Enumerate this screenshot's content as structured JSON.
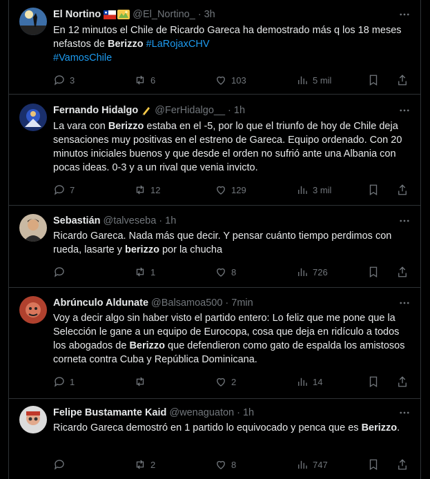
{
  "tweets": [
    {
      "name": "El Nortino",
      "handle": "@El_Nortino_",
      "time": "3h",
      "text_1": "En 12 minutos el Chile de Ricardo Gareca ha demostrado más q los 18 meses nefastos de ",
      "text_2": "Berizzo",
      "text_3": " ",
      "text_4": "#LaRojaxCHV",
      "text_5": "#VamosChile",
      "replies": "3",
      "reposts": "6",
      "likes": "103",
      "views": "5 mil"
    },
    {
      "name": "Fernando Hidalgo",
      "handle": "@FerHidalgo__",
      "time": "1h",
      "text_1": "La vara con ",
      "text_2": "Berizzo",
      "text_3": " estaba en el -5, por lo que el triunfo de hoy de Chile deja sensaciones muy positivas en el estreno de Gareca. Equipo ordenado. Con 20 minutos iniciales buenos y que desde el orden no sufrió ante una Albania con pocas ideas. 0-3 y a un rival que venia invicto.",
      "replies": "7",
      "reposts": "12",
      "likes": "129",
      "views": "3 mil"
    },
    {
      "name": "Sebastián",
      "handle": "@talveseba",
      "time": "1h",
      "text_1": "Ricardo Gareca. Nada más que decir. Y pensar cuánto tiempo perdimos con rueda, lasarte y ",
      "text_2": "berizzo",
      "text_3": " por la chucha",
      "replies": "",
      "reposts": "1",
      "likes": "8",
      "views": "726"
    },
    {
      "name": "Abrúnculo Aldunate",
      "handle": "@Balsamoa500",
      "time": "7min",
      "text_1": "Voy a decir algo sin haber visto el partido entero: Lo feliz que me pone que la Selección le gane a un equipo de Eurocopa, cosa que deja en ridículo a todos los abogados de ",
      "text_2": "Berizzo",
      "text_3": " que defendieron como gato de espalda los amistosos corneta contra Cuba y República Dominicana.",
      "replies": "1",
      "reposts": "",
      "likes": "2",
      "views": "14"
    },
    {
      "name": "Felipe Bustamante Kaid",
      "handle": "@wenaguaton",
      "time": "1h",
      "text_1": "Ricardo Gareca demostró en 1 partido lo equivocado y penca que es ",
      "text_2": "Berizzo",
      "text_3": ".",
      "replies": "",
      "reposts": "2",
      "likes": "8",
      "views": "747"
    }
  ],
  "separator": "·",
  "icons": {
    "reply": "reply-icon",
    "repost": "repost-icon",
    "like": "heart-icon",
    "views": "views-icon",
    "bookmark": "bookmark-icon",
    "share": "share-icon",
    "more": "more-icon"
  },
  "colors": {
    "background": "#000000",
    "text": "#e7e9ea",
    "secondary": "#71767b",
    "link": "#1d9bf0",
    "border": "#2f3336"
  }
}
